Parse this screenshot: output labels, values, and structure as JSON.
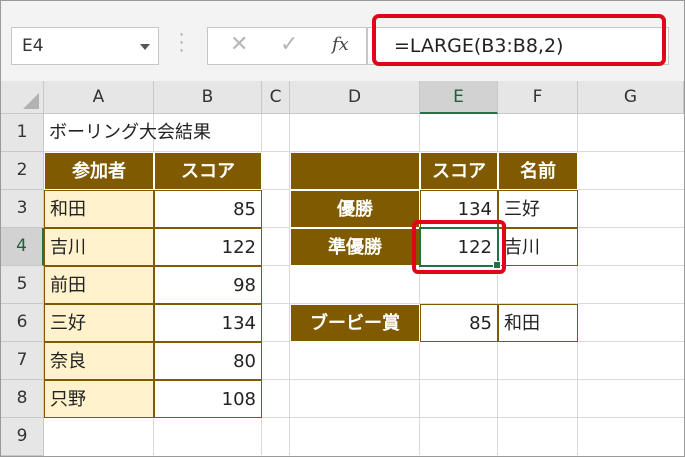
{
  "name_box": {
    "value": "E4"
  },
  "formula_bar": {
    "cancel_glyph": "✕",
    "enter_glyph": "✓",
    "fx_label": "fx",
    "formula": "=LARGE(B3:B8,2)"
  },
  "columns": [
    "A",
    "B",
    "C",
    "D",
    "E",
    "F",
    "G"
  ],
  "rows": [
    "1",
    "2",
    "3",
    "4",
    "5",
    "6",
    "7",
    "8",
    "9"
  ],
  "sheet": {
    "title": "ボーリング大会結果",
    "participants_table": {
      "headers": [
        "参加者",
        "スコア"
      ],
      "rows": [
        {
          "name": "和田",
          "score": "85"
        },
        {
          "name": "吉川",
          "score": "122"
        },
        {
          "name": "前田",
          "score": "98"
        },
        {
          "name": "三好",
          "score": "134"
        },
        {
          "name": "奈良",
          "score": "80"
        },
        {
          "name": "只野",
          "score": "108"
        }
      ]
    },
    "results_table": {
      "headers": [
        "スコア",
        "名前"
      ],
      "rows": [
        {
          "label": "優勝",
          "score": "134",
          "name": "三好"
        },
        {
          "label": "準優勝",
          "score": "122",
          "name": "吉川"
        },
        {
          "label": "ブービー賞",
          "score": "85",
          "name": "和田"
        }
      ]
    }
  },
  "colors": {
    "header_fill": "#7f5a00",
    "name_fill": "#fff2cc",
    "highlight_red": "#e0061a",
    "selection_green": "#217346"
  },
  "selected_cell": "E4"
}
